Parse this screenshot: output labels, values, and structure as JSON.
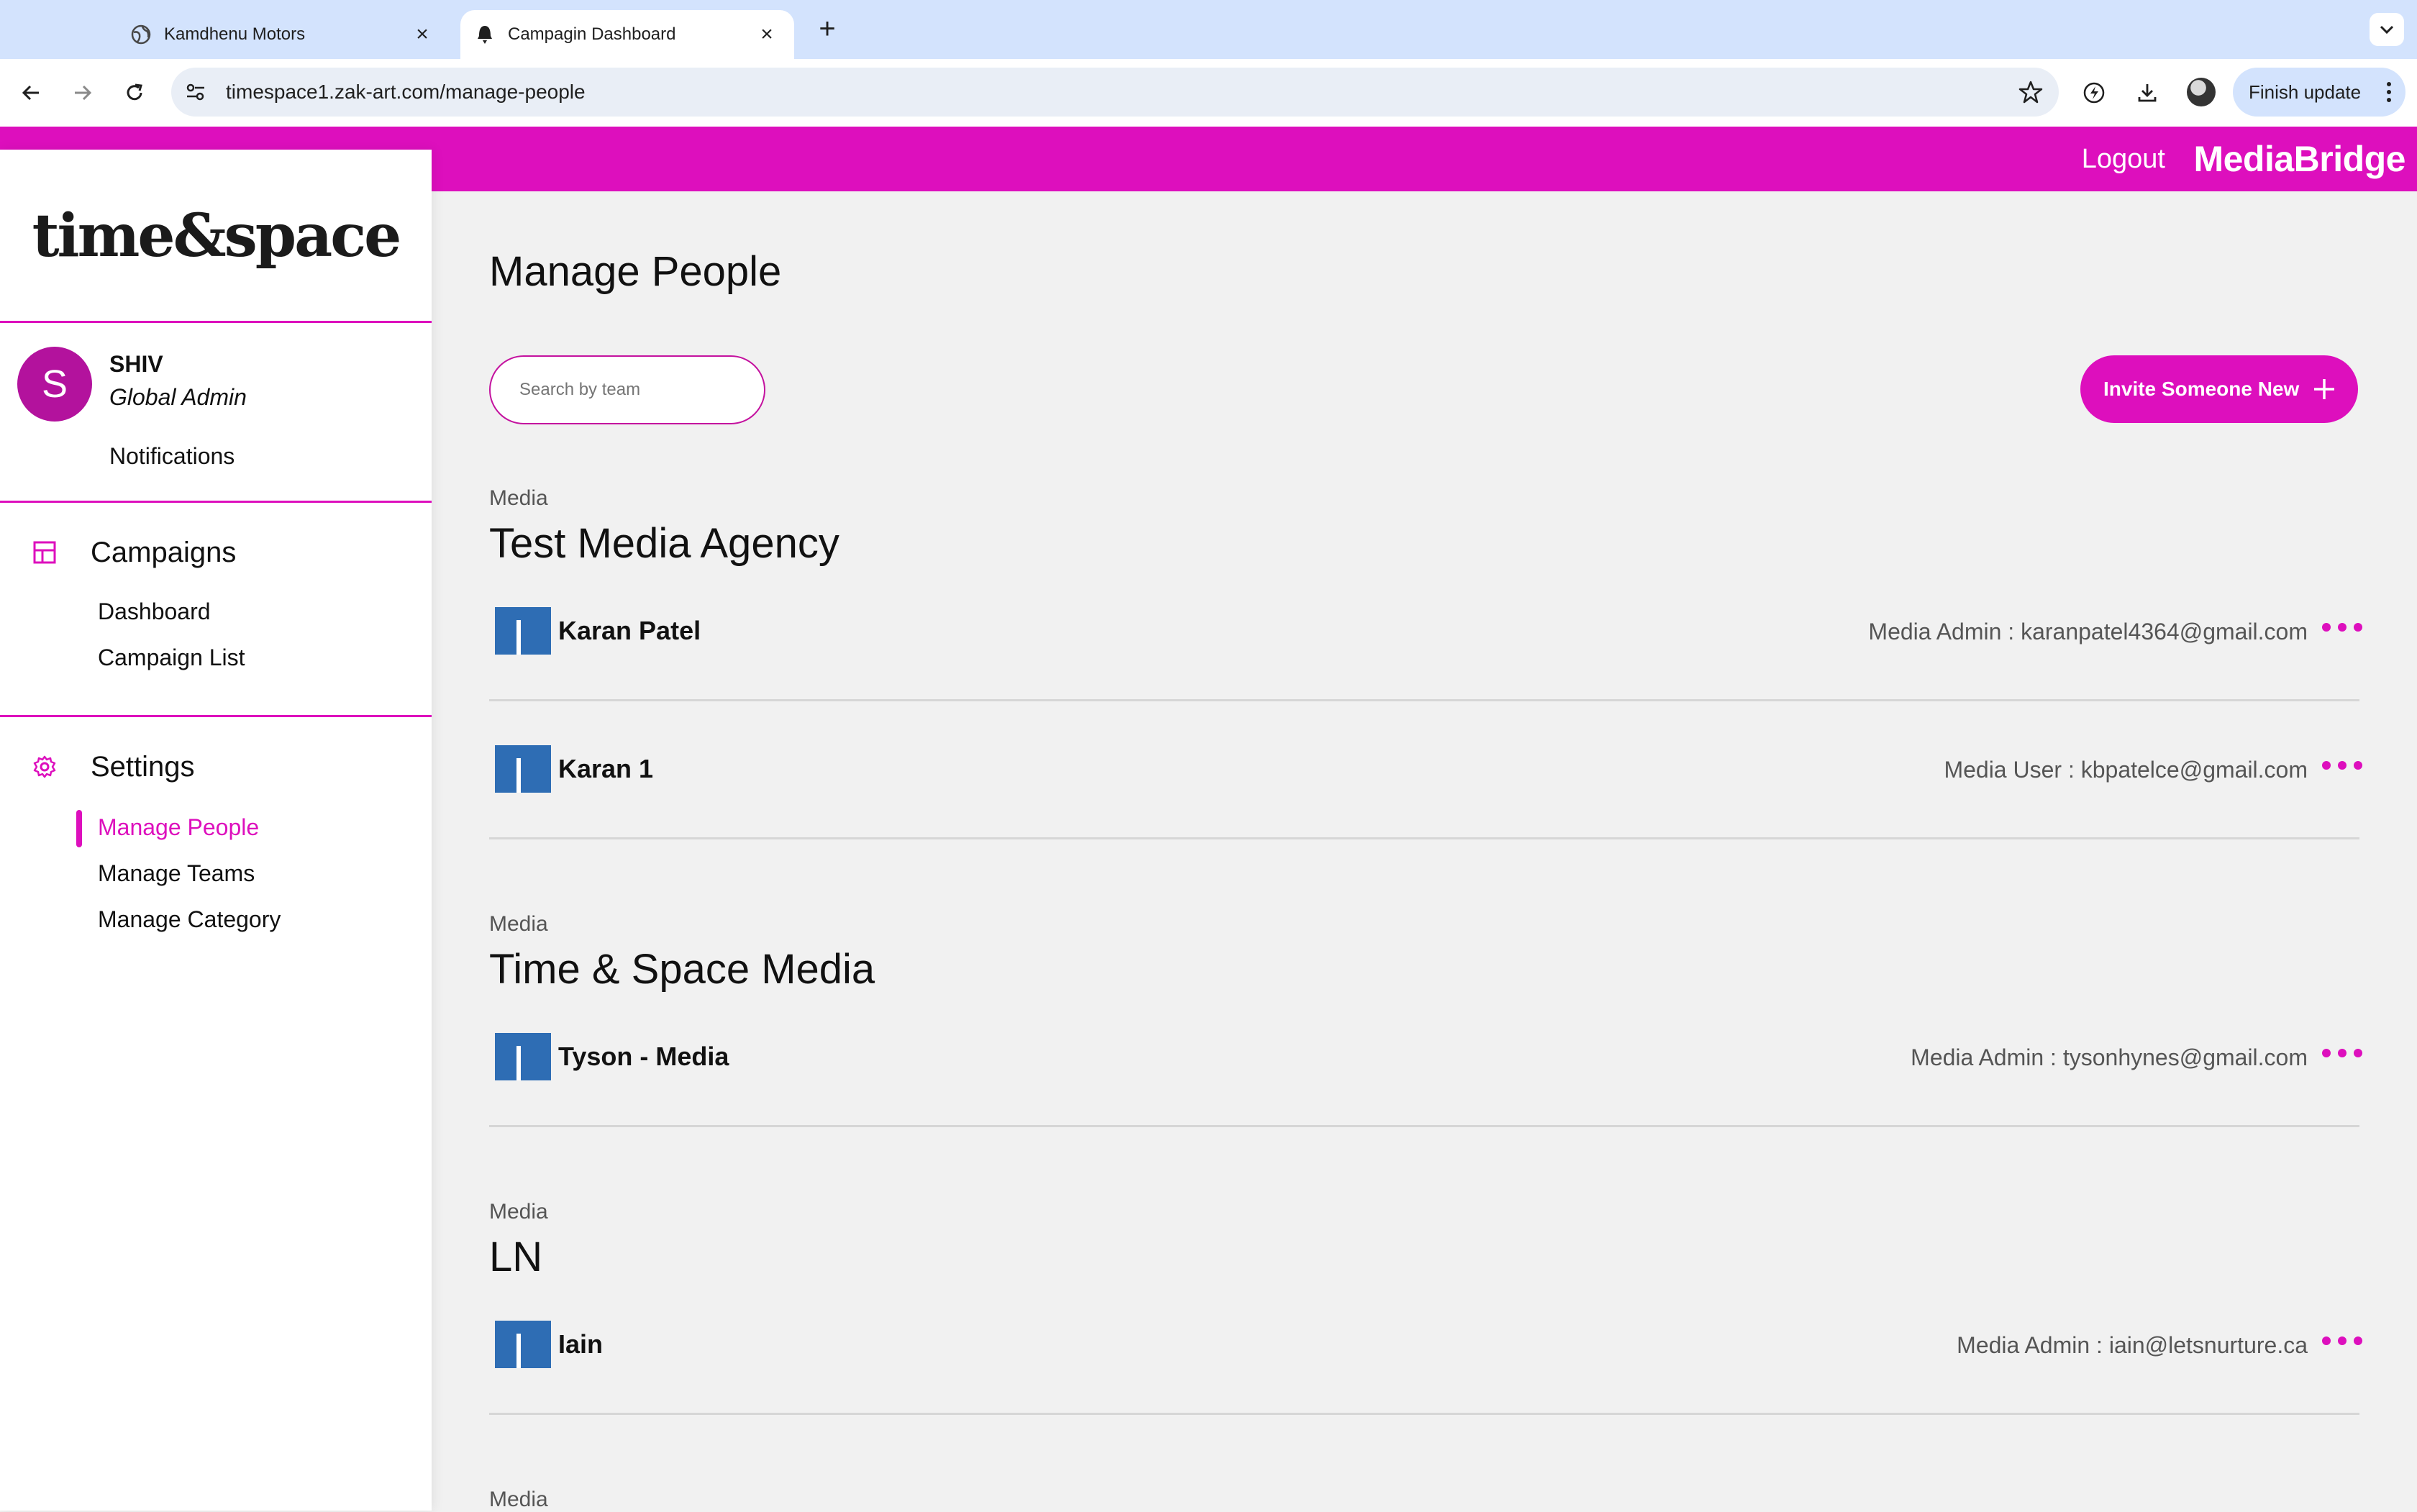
{
  "browser": {
    "tabs": [
      {
        "title": "Kamdhenu Motors",
        "active": false
      },
      {
        "title": "Campagin Dashboard",
        "active": true
      }
    ],
    "url": "timespace1.zak-art.com/manage-people",
    "update_button": "Finish update"
  },
  "header": {
    "logout": "Logout",
    "brand": "MediaBridge",
    "color": "#dd0fbd"
  },
  "sidebar": {
    "logo": "time&space",
    "user": {
      "initial": "S",
      "name": "SHIV",
      "role": "Global Admin"
    },
    "notifications": "Notifications",
    "sections": [
      {
        "title": "Campaigns",
        "icon": "grid-icon",
        "items": [
          "Dashboard",
          "Campaign List"
        ]
      },
      {
        "title": "Settings",
        "icon": "gear-icon",
        "items": [
          "Manage People",
          "Manage Teams",
          "Manage Category"
        ],
        "active_item": "Manage People"
      }
    ]
  },
  "main": {
    "title": "Manage People",
    "search_placeholder": "Search by team",
    "invite_button": "Invite Someone New",
    "teams": [
      {
        "kind": "Media",
        "name": "Test Media Agency",
        "members": [
          {
            "name": "Karan Patel",
            "role": "Media Admin",
            "email": "karanpatel4364@gmail.com"
          },
          {
            "name": "Karan 1",
            "role": "Media User",
            "email": "kbpatelce@gmail.com"
          }
        ]
      },
      {
        "kind": "Media",
        "name": "Time & Space Media",
        "members": [
          {
            "name": "Tyson - Media",
            "role": "Media Admin",
            "email": "tysonhynes@gmail.com"
          }
        ]
      },
      {
        "kind": "Media",
        "name": "LN",
        "members": [
          {
            "name": "Iain",
            "role": "Media Admin",
            "email": "iain@letsnurture.ca"
          }
        ]
      },
      {
        "kind": "Media",
        "name": "",
        "members": []
      }
    ]
  }
}
